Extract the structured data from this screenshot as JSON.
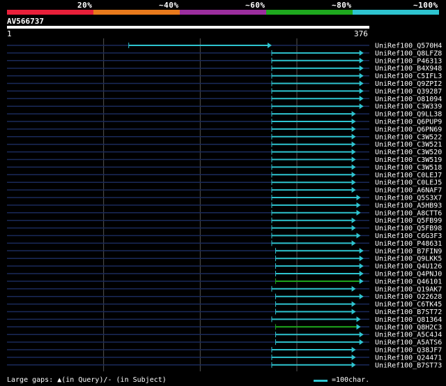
{
  "legend": [
    {
      "label": "20%",
      "color": "#e8203a"
    },
    {
      "label": "~40%",
      "color": "#e87a1c"
    },
    {
      "label": "~60%",
      "color": "#9b2e9e"
    },
    {
      "label": "~80%",
      "color": "#1ea81e"
    },
    {
      "label": "~100%",
      "color": "#2ec4d0"
    }
  ],
  "query": {
    "name": "AV566737",
    "start": "1",
    "end": "376"
  },
  "footer": {
    "gaps_text": "Large gaps: ▲(in Query)/- (in Subject)",
    "scale_text": "=100char."
  },
  "chart_data": {
    "type": "alignment",
    "query_length": 376,
    "hits": [
      {
        "name": "UniRef100_Q570H4",
        "start": 127,
        "end": 275,
        "identity": "~100%"
      },
      {
        "name": "UniRef100_Q8LFZ8",
        "start": 275,
        "end": 370,
        "identity": "~100%"
      },
      {
        "name": "UniRef100_P46313",
        "start": 275,
        "end": 370,
        "identity": "~100%"
      },
      {
        "name": "UniRef100_B4X948",
        "start": 275,
        "end": 370,
        "identity": "~100%"
      },
      {
        "name": "UniRef100_C5IFL3",
        "start": 275,
        "end": 370,
        "identity": "~100%"
      },
      {
        "name": "UniRef100_Q9ZPI2",
        "start": 275,
        "end": 370,
        "identity": "~100%"
      },
      {
        "name": "UniRef100_Q39287",
        "start": 275,
        "end": 370,
        "identity": "~100%"
      },
      {
        "name": "UniRef100_O81094",
        "start": 275,
        "end": 370,
        "identity": "~100%"
      },
      {
        "name": "UniRef100_C3W339",
        "start": 275,
        "end": 370,
        "identity": "~100%"
      },
      {
        "name": "UniRef100_Q9LL38",
        "start": 275,
        "end": 362,
        "identity": "~100%"
      },
      {
        "name": "UniRef100_Q6PUP9",
        "start": 275,
        "end": 362,
        "identity": "~100%"
      },
      {
        "name": "UniRef100_Q6PN69",
        "start": 275,
        "end": 362,
        "identity": "~100%"
      },
      {
        "name": "UniRef100_C3W522",
        "start": 275,
        "end": 362,
        "identity": "~100%"
      },
      {
        "name": "UniRef100_C3W521",
        "start": 275,
        "end": 362,
        "identity": "~100%"
      },
      {
        "name": "UniRef100_C3W520",
        "start": 275,
        "end": 362,
        "identity": "~100%"
      },
      {
        "name": "UniRef100_C3W519",
        "start": 275,
        "end": 362,
        "identity": "~100%"
      },
      {
        "name": "UniRef100_C3W518",
        "start": 275,
        "end": 362,
        "identity": "~100%"
      },
      {
        "name": "UniRef100_C0LEJ7",
        "start": 275,
        "end": 362,
        "identity": "~100%"
      },
      {
        "name": "UniRef100_C0LEJ5",
        "start": 275,
        "end": 362,
        "identity": "~100%"
      },
      {
        "name": "UniRef100_A6NAF7",
        "start": 275,
        "end": 362,
        "identity": "~100%"
      },
      {
        "name": "UniRef100_Q5S3X7",
        "start": 275,
        "end": 367,
        "identity": "~100%"
      },
      {
        "name": "UniRef100_A5HB93",
        "start": 275,
        "end": 367,
        "identity": "~100%"
      },
      {
        "name": "UniRef100_A8CTT6",
        "start": 275,
        "end": 367,
        "identity": "~100%"
      },
      {
        "name": "UniRef100_Q5FB99",
        "start": 275,
        "end": 362,
        "identity": "~100%"
      },
      {
        "name": "UniRef100_Q5FB98",
        "start": 275,
        "end": 362,
        "identity": "~100%"
      },
      {
        "name": "UniRef100_C6G3F3",
        "start": 275,
        "end": 367,
        "identity": "~100%"
      },
      {
        "name": "UniRef100_P48631",
        "start": 275,
        "end": 362,
        "identity": "~100%"
      },
      {
        "name": "UniRef100_B7FIN9",
        "start": 279,
        "end": 370,
        "identity": "~100%"
      },
      {
        "name": "UniRef100_Q9LKK5",
        "start": 279,
        "end": 370,
        "identity": "~100%"
      },
      {
        "name": "UniRef100_Q4U126",
        "start": 279,
        "end": 370,
        "identity": "~100%"
      },
      {
        "name": "UniRef100_Q4PNJ0",
        "start": 279,
        "end": 370,
        "identity": "~100%"
      },
      {
        "name": "UniRef100_Q46101",
        "start": 279,
        "end": 370,
        "identity": "~80%"
      },
      {
        "name": "UniRef100_Q19AK7",
        "start": 275,
        "end": 362,
        "identity": "~100%"
      },
      {
        "name": "UniRef100_O22628",
        "start": 279,
        "end": 370,
        "identity": "~100%"
      },
      {
        "name": "UniRef100_C6TK45",
        "start": 279,
        "end": 362,
        "identity": "~100%"
      },
      {
        "name": "UniRef100_B7ST72",
        "start": 279,
        "end": 362,
        "identity": "~100%"
      },
      {
        "name": "UniRef100_Q81364",
        "start": 275,
        "end": 367,
        "identity": "~100%"
      },
      {
        "name": "UniRef100_Q8H2C3",
        "start": 279,
        "end": 367,
        "identity": "~80%"
      },
      {
        "name": "UniRef100_A5C4J4",
        "start": 279,
        "end": 370,
        "identity": "~100%"
      },
      {
        "name": "UniRef100_A5ATS6",
        "start": 279,
        "end": 370,
        "identity": "~100%"
      },
      {
        "name": "UniRef100_Q38JF7",
        "start": 275,
        "end": 362,
        "identity": "~100%"
      },
      {
        "name": "UniRef100_Q24471",
        "start": 275,
        "end": 362,
        "identity": "~100%"
      },
      {
        "name": "UniRef100_B7ST73",
        "start": 275,
        "end": 362,
        "identity": "~100%"
      }
    ]
  }
}
